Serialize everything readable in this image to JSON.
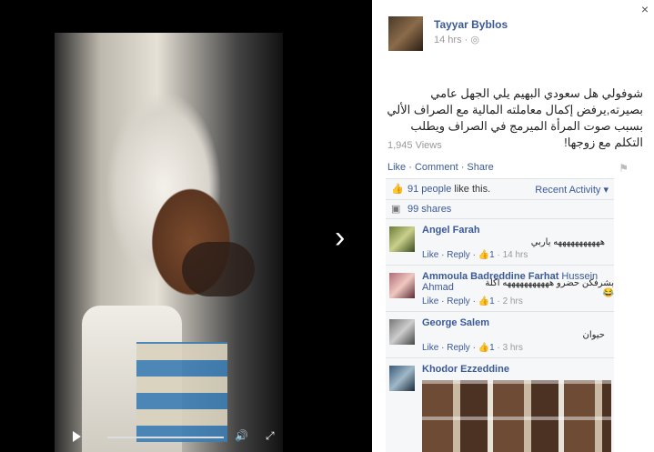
{
  "post": {
    "author": "Tayyar Byblos",
    "time": "14 hrs",
    "text": "شوفولي هل سعودي البهيم يلي الجهل عامي بصيرته,يرفض إكمال معاملته المالية مع الصراف الألي بسبب صوت المرأة الميرمج في الصراف ويطلب التكلم مع زوجها!",
    "views": "1,945 Views",
    "actions": "Like · Comment · Share",
    "likes_count": "91 people",
    "likes_suffix": " like this.",
    "recent": "Recent Activity ▾",
    "shares": "99 shares"
  },
  "comments": [
    {
      "name": "Angel Farah",
      "body": "هههههههههههه ياربي",
      "actions": "Like · Reply · ",
      "likes": "1",
      "time": " · 14 hrs"
    },
    {
      "name": "Ammoula Badreddine Farhat",
      "tag": " Hussein Ahmad",
      "body": "بشرفكن حضرو هههههههههههه اكلة 😂",
      "actions": "Like · Reply · ",
      "likes": "1",
      "time": " · 2 hrs"
    },
    {
      "name": "George Salem",
      "body": "حيوان",
      "actions": "Like · Reply · ",
      "likes": "1",
      "time": " · 3 hrs"
    },
    {
      "name": "Khodor Ezzeddine"
    }
  ],
  "icons": {
    "close": "×",
    "next": "›",
    "volume": "🔊",
    "fullscreen": "⤢",
    "globe": "◎",
    "like": "👍",
    "share": "▣",
    "flag": "⚑"
  }
}
